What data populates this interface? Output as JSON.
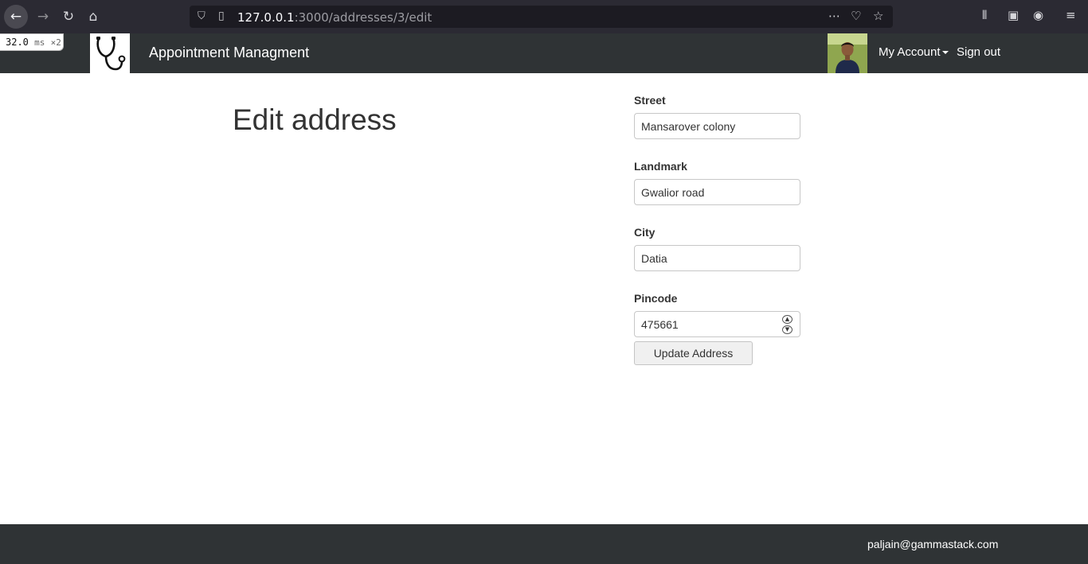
{
  "browser": {
    "url_host": "127.0.0.1",
    "url_path": ":3000/addresses/3/edit",
    "perf_value": "32.0",
    "perf_unit": "ms",
    "perf_mult": "×2"
  },
  "navbar": {
    "brand": "Appointment Managment",
    "account_label": "My Account",
    "signout_label": "Sign out"
  },
  "main": {
    "title": "Edit address"
  },
  "form": {
    "street": {
      "label": "Street",
      "value": "Mansarover colony"
    },
    "landmark": {
      "label": "Landmark",
      "value": "Gwalior road"
    },
    "city": {
      "label": "City",
      "value": "Datia"
    },
    "pincode": {
      "label": "Pincode",
      "value": "475661"
    },
    "submit_label": "Update Address"
  },
  "footer": {
    "email": "paljain@gammastack.com"
  },
  "colors": {
    "navbar_bg": "#2f3335",
    "chrome_bg": "#2b2a33"
  }
}
